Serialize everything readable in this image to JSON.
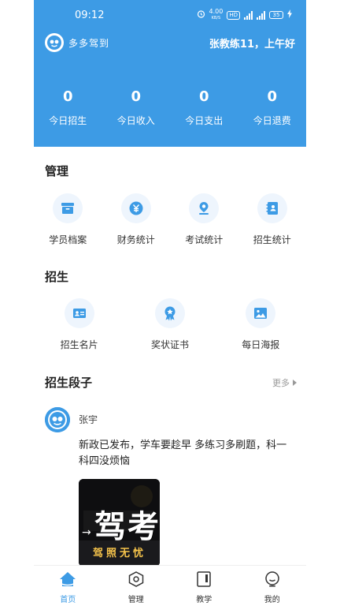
{
  "theme": {
    "brand_color": "#3d9be5",
    "icon_bg": "#eef5fd"
  },
  "status_bar": {
    "time": "09:12",
    "net_speed": "4.00",
    "net_unit": "KB/S",
    "hd_badge": "HD",
    "signal_label_1": "4G",
    "signal_label_2": "4G",
    "battery": "35"
  },
  "header": {
    "app_name": "多多驾到",
    "greeting": "张教练11，上午好",
    "stats": [
      {
        "value": "0",
        "label": "今日招生"
      },
      {
        "value": "0",
        "label": "今日收入"
      },
      {
        "value": "0",
        "label": "今日支出"
      },
      {
        "value": "0",
        "label": "今日退费"
      }
    ]
  },
  "management": {
    "title": "管理",
    "items": [
      {
        "label": "学员档案",
        "icon": "archive-box-icon"
      },
      {
        "label": "财务统计",
        "icon": "yuan-coin-icon"
      },
      {
        "label": "考试统计",
        "icon": "exam-pin-icon"
      },
      {
        "label": "招生统计",
        "icon": "contacts-book-icon"
      }
    ]
  },
  "recruit": {
    "title": "招生",
    "items": [
      {
        "label": "招生名片",
        "icon": "id-card-icon"
      },
      {
        "label": "奖状证书",
        "icon": "award-ribbon-icon"
      },
      {
        "label": "每日海报",
        "icon": "image-poster-icon"
      }
    ]
  },
  "posts_section": {
    "title": "招生段子",
    "more_label": "更多"
  },
  "post": {
    "author": "张宇",
    "text": "新政已发布，学车要趁早 多练习多刷题，科一科四没烦恼",
    "image_main_text": "驾考",
    "image_sub_text": "驾照无忧",
    "image_arrow": "→"
  },
  "tabbar": {
    "tabs": [
      {
        "label": "首页",
        "icon": "home-icon",
        "active": true
      },
      {
        "label": "管理",
        "icon": "hexagon-gear-icon",
        "active": false
      },
      {
        "label": "教学",
        "icon": "book-icon",
        "active": false
      },
      {
        "label": "我的",
        "icon": "profile-smile-icon",
        "active": false
      }
    ]
  }
}
